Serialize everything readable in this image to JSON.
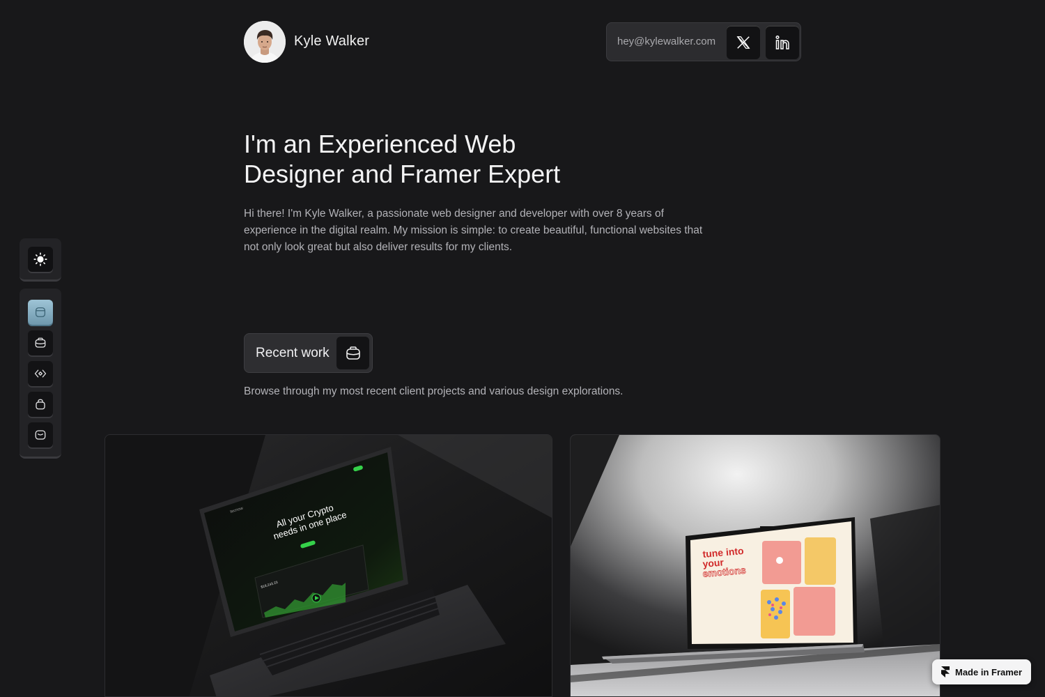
{
  "header": {
    "name": "Kyle Walker",
    "email": "hey@kylewalker.com",
    "x_icon": "x-logo-icon",
    "linkedin_icon": "linkedin-icon"
  },
  "hero": {
    "title_line1": "I'm an Experienced Web",
    "title_line2": "Designer and Framer Expert",
    "intro": "Hi there! I'm Kyle Walker, a passionate web designer and developer with over 8 years of experience in the digital realm. My mission is simple: to create beautiful, functional websites that not only look great but also deliver results for my clients."
  },
  "recent_work": {
    "label": "Recent work",
    "description": "Browse through my most recent client projects and various design explorations."
  },
  "sidebar": {
    "theme_icon": "sun-icon",
    "nav_icons": [
      "home-icon",
      "briefcase-icon",
      "code-icon",
      "bag-icon",
      "mail-icon"
    ],
    "active_index": 0
  },
  "projects": [
    {
      "screen_brand": "tecnow",
      "screen_headline_1": "All your Crypto",
      "screen_headline_2": "needs in one place",
      "screen_balance": "$18,243.23"
    },
    {
      "screen_headline_1": "tune into",
      "screen_headline_2": "your",
      "screen_headline_3": "emotions"
    }
  ],
  "badge": {
    "label": "Made in Framer"
  },
  "colors": {
    "background": "#18181a",
    "accent": "#8fb8cb",
    "crypto_green": "#35d14a",
    "emotions_red": "#e0322e"
  }
}
